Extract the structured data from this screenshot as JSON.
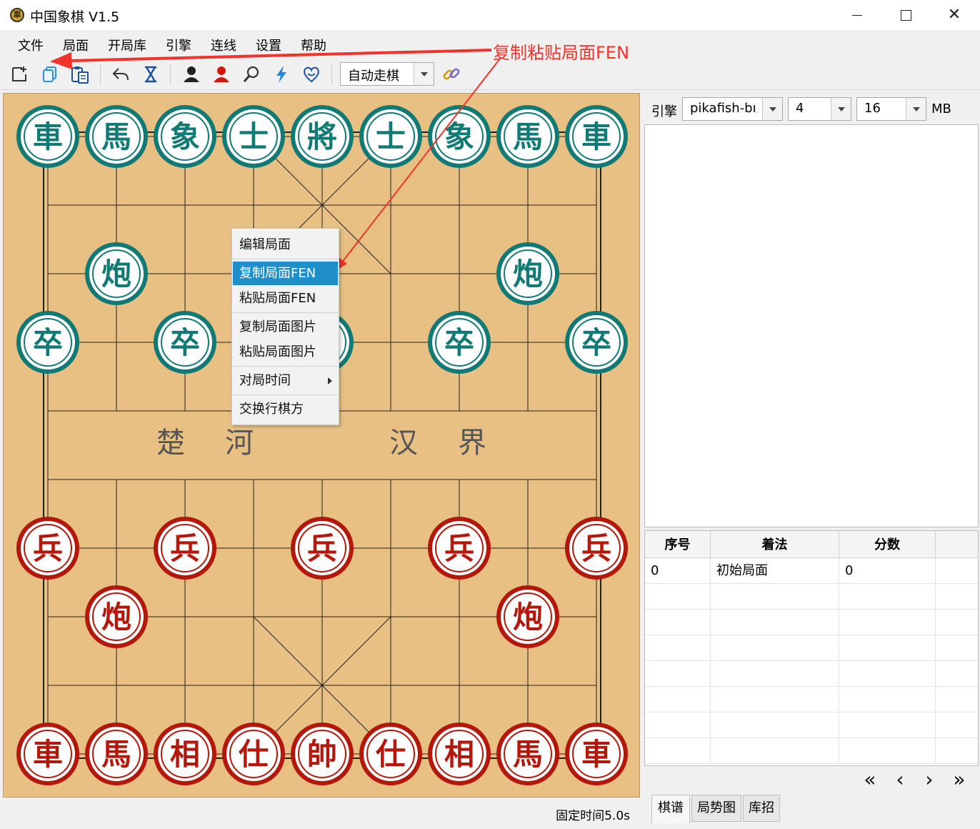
{
  "window": {
    "title": "中国象棋 V1.5",
    "app_icon_glyph": "車"
  },
  "menu": [
    "文件",
    "局面",
    "开局库",
    "引擎",
    "连线",
    "设置",
    "帮助"
  ],
  "toolbar": {
    "play_mode": "自动走棋",
    "icons": [
      "new-board-icon",
      "copy-icon",
      "paste-icon",
      "undo-icon",
      "hourglass-icon",
      "black-player-icon",
      "red-player-icon",
      "search-icon",
      "lightning-icon",
      "heart-icon",
      "link-icon"
    ]
  },
  "annotation": {
    "label": "复制粘贴局面FEN",
    "color": "#f0332b"
  },
  "board": {
    "river_left": [
      "楚",
      "河"
    ],
    "river_right": [
      "汉",
      "界"
    ],
    "colors": {
      "black_piece": "#127a74",
      "red_piece": "#b3180c",
      "board": "#e8c083"
    },
    "pieces": [
      {
        "t": "車",
        "s": "black",
        "c": 0,
        "r": 0
      },
      {
        "t": "馬",
        "s": "black",
        "c": 1,
        "r": 0
      },
      {
        "t": "象",
        "s": "black",
        "c": 2,
        "r": 0
      },
      {
        "t": "士",
        "s": "black",
        "c": 3,
        "r": 0
      },
      {
        "t": "將",
        "s": "black",
        "c": 4,
        "r": 0
      },
      {
        "t": "士",
        "s": "black",
        "c": 5,
        "r": 0
      },
      {
        "t": "象",
        "s": "black",
        "c": 6,
        "r": 0
      },
      {
        "t": "馬",
        "s": "black",
        "c": 7,
        "r": 0
      },
      {
        "t": "車",
        "s": "black",
        "c": 8,
        "r": 0
      },
      {
        "t": "炮",
        "s": "black",
        "c": 1,
        "r": 2
      },
      {
        "t": "炮",
        "s": "black",
        "c": 7,
        "r": 2
      },
      {
        "t": "卒",
        "s": "black",
        "c": 0,
        "r": 3
      },
      {
        "t": "卒",
        "s": "black",
        "c": 2,
        "r": 3
      },
      {
        "t": "卒",
        "s": "black",
        "c": 4,
        "r": 3
      },
      {
        "t": "卒",
        "s": "black",
        "c": 6,
        "r": 3
      },
      {
        "t": "卒",
        "s": "black",
        "c": 8,
        "r": 3
      },
      {
        "t": "兵",
        "s": "red",
        "c": 0,
        "r": 6
      },
      {
        "t": "兵",
        "s": "red",
        "c": 2,
        "r": 6
      },
      {
        "t": "兵",
        "s": "red",
        "c": 4,
        "r": 6
      },
      {
        "t": "兵",
        "s": "red",
        "c": 6,
        "r": 6
      },
      {
        "t": "兵",
        "s": "red",
        "c": 8,
        "r": 6
      },
      {
        "t": "炮",
        "s": "red",
        "c": 1,
        "r": 7
      },
      {
        "t": "炮",
        "s": "red",
        "c": 7,
        "r": 7
      },
      {
        "t": "車",
        "s": "red",
        "c": 0,
        "r": 9
      },
      {
        "t": "馬",
        "s": "red",
        "c": 1,
        "r": 9
      },
      {
        "t": "相",
        "s": "red",
        "c": 2,
        "r": 9
      },
      {
        "t": "仕",
        "s": "red",
        "c": 3,
        "r": 9
      },
      {
        "t": "帥",
        "s": "red",
        "c": 4,
        "r": 9
      },
      {
        "t": "仕",
        "s": "red",
        "c": 5,
        "r": 9
      },
      {
        "t": "相",
        "s": "red",
        "c": 6,
        "r": 9
      },
      {
        "t": "馬",
        "s": "red",
        "c": 7,
        "r": 9
      },
      {
        "t": "車",
        "s": "red",
        "c": 8,
        "r": 9
      }
    ]
  },
  "context_menu": {
    "items": [
      "编辑局面",
      "复制局面FEN",
      "粘贴局面FEN",
      "复制局面图片",
      "粘贴局面图片",
      "对局时间",
      "交换行棋方"
    ],
    "highlighted": "复制局面FEN"
  },
  "status": {
    "text": "固定时间5.0s"
  },
  "engine": {
    "label": "引擎",
    "name": "pikafish-bı",
    "threads": "4",
    "hash": "16",
    "hash_unit": "MB"
  },
  "moves": {
    "headers": [
      "序号",
      "着法",
      "分数"
    ],
    "rows": [
      [
        "0",
        "初始局面",
        "0"
      ]
    ]
  },
  "nav": [
    "«",
    "‹",
    "›",
    "»"
  ],
  "tabs": [
    "棋谱",
    "局势图",
    "库招"
  ]
}
